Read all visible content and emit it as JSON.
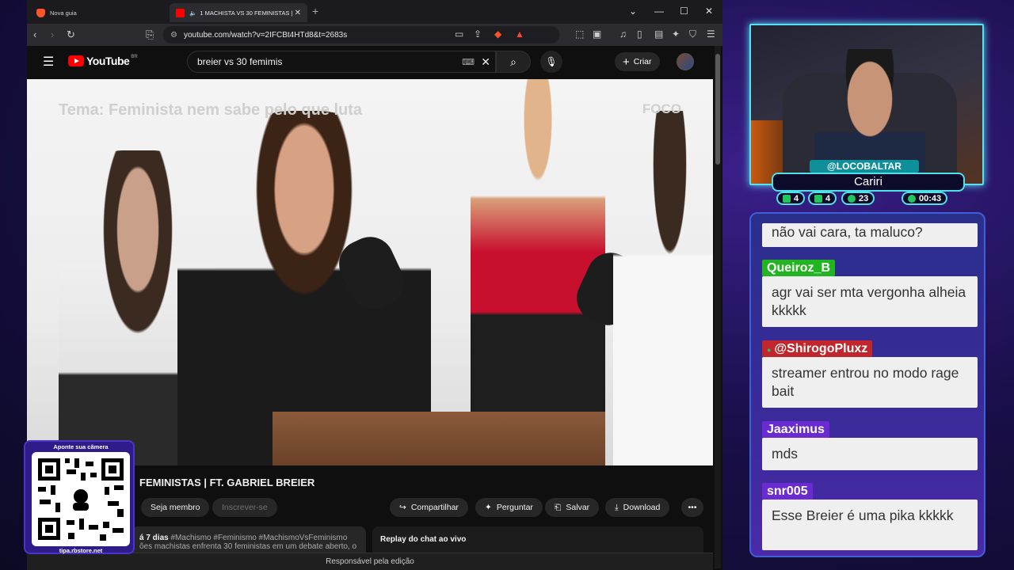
{
  "browser": {
    "tabs": [
      {
        "label": "Nova guia"
      },
      {
        "label": "1 MACHISTA VS 30 FEMINISTAS | FT"
      }
    ],
    "url": "youtube.com/watch?v=2IFCBt4HTd8&t=2683s"
  },
  "youtube": {
    "logo_text": "YouTube",
    "country_code": "BR",
    "search_value": "breier vs 30 femimis",
    "create_label": "Criar"
  },
  "video": {
    "overlay_title": "Tema: Feminista nem sabe pelo que luta",
    "brand": "FOCO",
    "heading": "FEMINISTAS | FT. GABRIEL BREIER",
    "join_label": "Seja membro",
    "subscribe_label": "Inscrever-se",
    "share_label": "Compartilhar",
    "ask_label": "Perguntar",
    "save_label": "Salvar",
    "download_label": "Download",
    "desc_meta": "á 7 dias",
    "desc_tags": "#Machismo #Feminismo #MachismoVsFeminismo",
    "desc_text": "ões machistas enfrenta 30 feministas em um debate aberto, o",
    "chat_replay": "Replay do chat ao vivo",
    "footer": "Responsável pela edição"
  },
  "qr": {
    "title": "Aponte sua câmera",
    "url": "tipa.rbstore.net"
  },
  "stream": {
    "streamer": "@LOCOBALTAR",
    "game": "Cariri",
    "stats": [
      {
        "icon": "chat-icon",
        "value": "4",
        "color": "#22c55e"
      },
      {
        "icon": "youtube-icon",
        "value": "4",
        "color": "#22c55e"
      },
      {
        "icon": "viewers-icon",
        "value": "23",
        "color": "#22c55e"
      },
      {
        "icon": "clock-icon",
        "value": "00:43",
        "color": "#22c55e"
      }
    ]
  },
  "chat": {
    "messages": [
      {
        "user": "",
        "text": "não vai cara, ta maluco?",
        "color": ""
      },
      {
        "user": "Queiroz_B",
        "text": "agr vai ser mta vergonha alheia kkkkk",
        "color": "#22b521"
      },
      {
        "user": "@ShirogoPluxz",
        "text": "streamer entrou no modo rage bait",
        "color": "#c0262b"
      },
      {
        "user": "Jaaximus",
        "text": "mds",
        "color": "#6a2bd0"
      },
      {
        "user": "snr005",
        "text": "Esse Breier é uma pika kkkkk",
        "color": "#6a2bd0"
      }
    ]
  }
}
